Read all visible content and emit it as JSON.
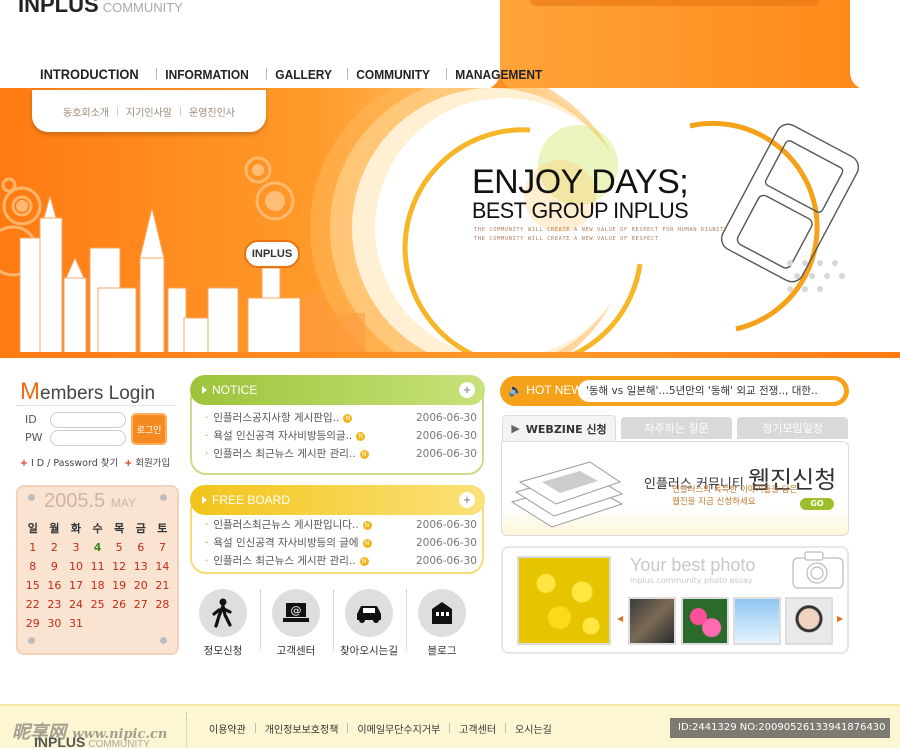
{
  "brand": {
    "logo": "INPLUS",
    "logo_sub": "COMMUNITY",
    "badge": "INPLUS"
  },
  "nav": {
    "items": [
      "INTRODUCTION",
      "INFORMATION",
      "GALLERY",
      "COMMUNITY",
      "MANAGEMENT"
    ],
    "active": "INTRODUCTION",
    "sub_items": [
      "동호회소개",
      "지기인사말",
      "운영진인사"
    ]
  },
  "banner": {
    "headline": "ENJOY DAYS;",
    "subheadline": "BEST GROUP INPLUS",
    "tagline_1": "THE COMMUNITY WILL CREATE A NEW VALUE OF RESPECT FOR HUMAN DIGNITY",
    "tagline_2": "THE COMMUNITY WILL CREATE A NEW VALUE OF RESPECT",
    "colors": {
      "primary_orange": "#ff8e22",
      "ring_orange": "#f5a21a",
      "ring_yellow": "#f6c12e"
    }
  },
  "login": {
    "title_first": "M",
    "title_rest": "embers Login",
    "id_label": "ID",
    "pw_label": "PW",
    "button": "로그인",
    "find_link": "I D / Password 찾기",
    "join_link": "회원가입"
  },
  "calendar": {
    "year_month": "2005.5",
    "month_name": "MAY",
    "weekdays": [
      "일",
      "월",
      "화",
      "수",
      "목",
      "금",
      "토"
    ],
    "days": [
      "1",
      "2",
      "3",
      "4",
      "5",
      "6",
      "7",
      "8",
      "9",
      "10",
      "11",
      "12",
      "13",
      "14",
      "15",
      "16",
      "17",
      "18",
      "19",
      "20",
      "21",
      "22",
      "23",
      "24",
      "25",
      "26",
      "27",
      "28",
      "29",
      "30",
      "31"
    ],
    "today": "4"
  },
  "notice": {
    "title": "NOTICE",
    "posts": [
      {
        "title": "인플러스공지사항  게시판입..",
        "date": "2006-06-30"
      },
      {
        "title": "욕설 인신공격 자사비방등의글..",
        "date": "2006-06-30"
      },
      {
        "title": "인플러스 최근뉴스 게시판 관리..",
        "date": "2006-06-30"
      }
    ]
  },
  "free_board": {
    "title": "FREE BOARD",
    "posts": [
      {
        "title": "인플러스최근뉴스  게시판입니다..",
        "date": "2006-06-30"
      },
      {
        "title": "욕설 인신공격 자사비방등의 글에",
        "date": "2006-06-30"
      },
      {
        "title": "인플러스 최근뉴스 게시판 관리..",
        "date": "2006-06-30"
      }
    ]
  },
  "new_marker": "N",
  "quick_links": [
    {
      "label": "정모신청",
      "icon": "walking-person-icon"
    },
    {
      "label": "고객센터",
      "icon": "at-sign-laptop-icon"
    },
    {
      "label": "찾아오시는길",
      "icon": "car-icon"
    },
    {
      "label": "블로그",
      "icon": "blog-house-icon"
    }
  ],
  "hot_news": {
    "label": "HOT NEWS",
    "headline": "'동해 vs 일본해'…5년만의 '동해' 외교 전쟁.., 대한.."
  },
  "webzine": {
    "tabs": [
      "WEBZINE 신청",
      "자주하는 질문",
      "정기모임일정"
    ],
    "title_small": "인플러스 커뮤니티",
    "title_big": "웹진신청",
    "desc_1": "인플러스의 독특한 이야기들을 담은",
    "desc_2": "웹진을 지금 신청하세요",
    "go_button": "GO"
  },
  "photo": {
    "title": "Your best photo",
    "subtitle": "inplus community photo essay"
  },
  "footer": {
    "links": [
      "이용약관",
      "개인정보보호정책",
      "이메일무단수지거부",
      "고객센터",
      "오시는길"
    ],
    "logo": "INPLUS",
    "logo_sub": "COMMUNITY",
    "watermark": "昵享网",
    "watermark_url": "www.nipic.cn",
    "image_id": "ID:2441329 NO:20090526133941876430"
  }
}
